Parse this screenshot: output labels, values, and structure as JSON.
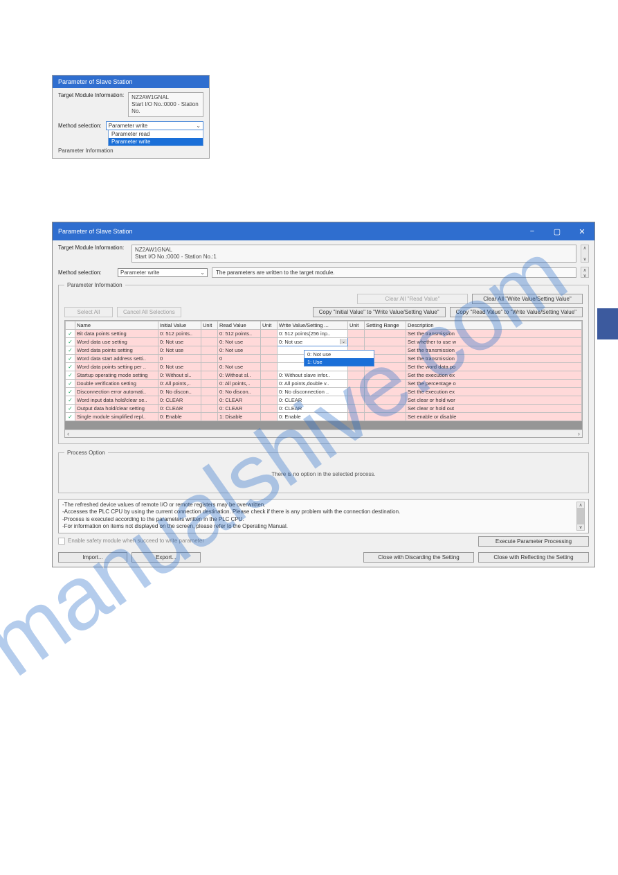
{
  "watermark": "manualshive.com",
  "small": {
    "title": "Parameter of Slave Station",
    "targetLabel": "Target Module Information:",
    "targetLine1": "NZ2AW1GNAL",
    "targetLine2": "Start I/O No.:0000 - Station No.",
    "methodLabel": "Method selection:",
    "methodValue": "Parameter write",
    "opt1": "Parameter read",
    "opt2": "Parameter write",
    "paramInfoLabel": "Parameter Information"
  },
  "large": {
    "title": "Parameter of Slave Station",
    "minimize": "−",
    "maximize": "▢",
    "close": "✕",
    "targetLabel": "Target Module Information:",
    "targetLine1": "NZ2AW1GNAL",
    "targetLine2": "Start I/O No.:0000 - Station No.:1",
    "methodLabel": "Method selection:",
    "methodValue": "Parameter write",
    "methodDesc": "The parameters are written to the target module.",
    "paramInfoLegend": "Parameter Information",
    "btnClearRead": "Clear All \"Read Value\"",
    "btnClearWrite": "Clear All \"Write Value/Setting Value\"",
    "btnSelectAll": "Select All",
    "btnCancelAll": "Cancel All Selections",
    "btnCopyInitial": "Copy \"Initial Value\" to \"Write Value/Setting Value\"",
    "btnCopyRead": "Copy \"Read Value\" to \"Write Value/Setting Value\"",
    "headers": {
      "ck": "",
      "name": "Name",
      "initial": "Initial Value",
      "unit1": "Unit",
      "read": "Read Value",
      "unit2": "Unit",
      "write": "Write Value/Setting ...",
      "unit3": "Unit",
      "range": "Setting Range",
      "desc": "Description"
    },
    "rows": [
      {
        "name": "Bit data points setting",
        "iv": "0: 512 points..",
        "rv": "0: 512 points..",
        "wv": "0: 512 points(256 inp..",
        "desc": "Set the transmission"
      },
      {
        "name": "Word data use setting",
        "iv": "0: Not use",
        "rv": "0: Not use",
        "wv": "0: Not use",
        "desc": "Set whether to use w",
        "open": true
      },
      {
        "name": "Word data points setting",
        "iv": "0: Not use",
        "rv": "0: Not use",
        "wv": "",
        "desc": "Set the transmission"
      },
      {
        "name": "Word data start address setti..",
        "iv": "0",
        "rv": "0",
        "wv": "",
        "desc": "Set the transmission"
      },
      {
        "name": "Word data points setting per ..",
        "iv": "0: Not use",
        "rv": "0: Not use",
        "wv": "",
        "desc": "Set the word data po"
      },
      {
        "name": "Startup operating mode setting",
        "iv": "0: Without sl..",
        "rv": "0: Without sl..",
        "wv": "0: Without slave infor..",
        "desc": "Set the execution ex"
      },
      {
        "name": "Double verification setting",
        "iv": "0: All points,..",
        "rv": "0: All points,..",
        "wv": "0: All points,double v..",
        "desc": "Set the percentage o"
      },
      {
        "name": "Disconnection error automati..",
        "iv": "0: No discon..",
        "rv": "0: No discon..",
        "wv": "0: No disconnection ..",
        "desc": "Set the execution ex"
      },
      {
        "name": "Word input data hold/clear se..",
        "iv": "0: CLEAR",
        "rv": "0: CLEAR",
        "wv": "0: CLEAR",
        "desc": "Set clear or hold wor"
      },
      {
        "name": "Output data hold/clear setting",
        "iv": "0: CLEAR",
        "rv": "0: CLEAR",
        "wv": "0: CLEAR",
        "desc": "Set clear or hold out"
      },
      {
        "name": "Single module simplified repl..",
        "iv": "0: Enable",
        "rv": "1: Disable",
        "wv": "0: Enable",
        "desc": "Set enable or disable"
      }
    ],
    "ddOpt1": "0: Not use",
    "ddOpt2": "1: Use",
    "scrollLeft": "‹",
    "scrollRight": "›",
    "processLegend": "Process Option",
    "processMsg": "There is no option in the selected process.",
    "note1": "-The refreshed device values of remote I/O or remote registers may be overwritten.",
    "note2": "-Accesses the PLC CPU by using the current connection destination. Please check if there is any problem with the connection destination.",
    "note3": "-Process is executed according to the parameters written in the PLC CPU.",
    "note4": "-For information on items not displayed on the screen, please refer to the Operating Manual.",
    "safetyChk": "Enable safety module when succeed to write parameter",
    "btnExecute": "Execute Parameter Processing",
    "btnImport": "Import...",
    "btnExport": "Export...",
    "btnDiscard": "Close with Discarding the Setting",
    "btnReflect": "Close with Reflecting the Setting"
  }
}
